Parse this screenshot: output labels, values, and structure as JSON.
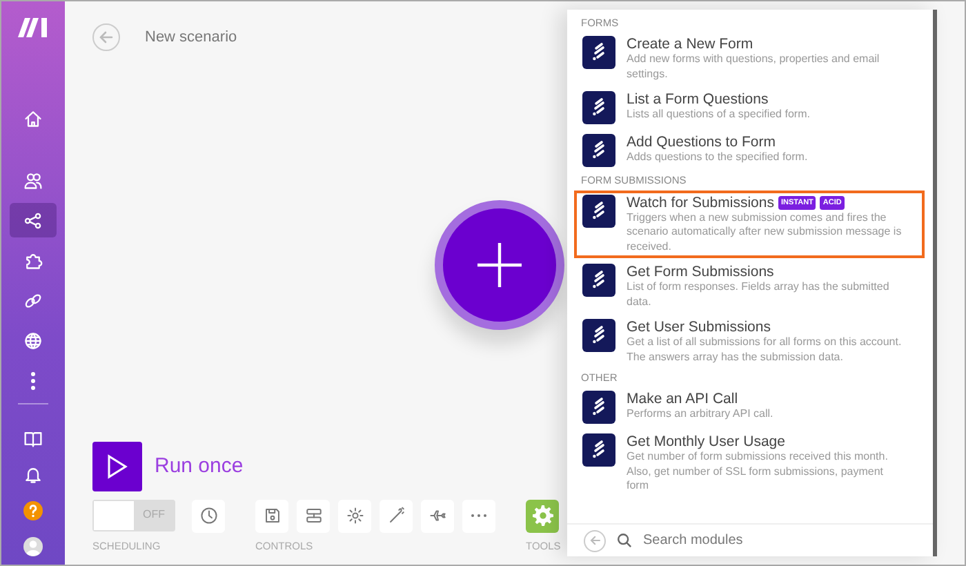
{
  "sidebar": {
    "items": [
      {
        "selected": false
      },
      {
        "selected": false
      },
      {
        "selected": true
      },
      {
        "selected": false
      },
      {
        "selected": false
      },
      {
        "selected": false
      },
      {
        "selected": false
      }
    ]
  },
  "header": {
    "title": "New scenario"
  },
  "run_once": {
    "label": "Run once"
  },
  "toolbar": {
    "groups": [
      {
        "label": "SCHEDULING",
        "items": [
          {
            "kind": "toggle",
            "text": "OFF",
            "on": false
          },
          {
            "kind": "clock"
          }
        ]
      },
      {
        "label": "CONTROLS",
        "items": [
          {
            "kind": "save"
          },
          {
            "kind": "flow"
          },
          {
            "kind": "gear"
          },
          {
            "kind": "wand"
          },
          {
            "kind": "plane"
          },
          {
            "kind": "dots"
          }
        ]
      },
      {
        "label": "TOOLS",
        "items": [
          {
            "kind": "tools"
          }
        ]
      }
    ]
  },
  "modules_panel": {
    "sections": [
      {
        "title": "FORMS",
        "modules": [
          {
            "name": "Create a New Form",
            "description": "Add new forms with questions, properties and email settings.",
            "highlighted": false
          },
          {
            "name": "List a Form Questions",
            "description": "Lists all questions of a specified form.",
            "highlighted": false
          },
          {
            "name": "Add Questions to Form",
            "description": "Adds questions to the specified form.",
            "highlighted": false
          }
        ]
      },
      {
        "title": "FORM SUBMISSIONS",
        "modules": [
          {
            "name": "Watch for Submissions",
            "description": "Triggers when a new submission comes and fires the scenario automatically after new submission message is received.",
            "badges": [
              "INSTANT",
              "ACID"
            ],
            "highlighted": true
          },
          {
            "name": "Get Form Submissions",
            "description": "List of form responses. Fields array has the submitted data.",
            "highlighted": false
          },
          {
            "name": "Get User Submissions",
            "description": "Get a list of all submissions for all forms on this account. The answers array has the submission data.",
            "highlighted": false
          }
        ]
      },
      {
        "title": "OTHER",
        "modules": [
          {
            "name": "Make an API Call",
            "description": "Performs an arbitrary API call.",
            "highlighted": false
          },
          {
            "name": "Get Monthly User Usage",
            "description": "Get number of form submissions received this month. Also, get number of SSL form submissions, payment form",
            "highlighted": false
          }
        ]
      }
    ],
    "search": {
      "placeholder": "Search modules"
    }
  }
}
